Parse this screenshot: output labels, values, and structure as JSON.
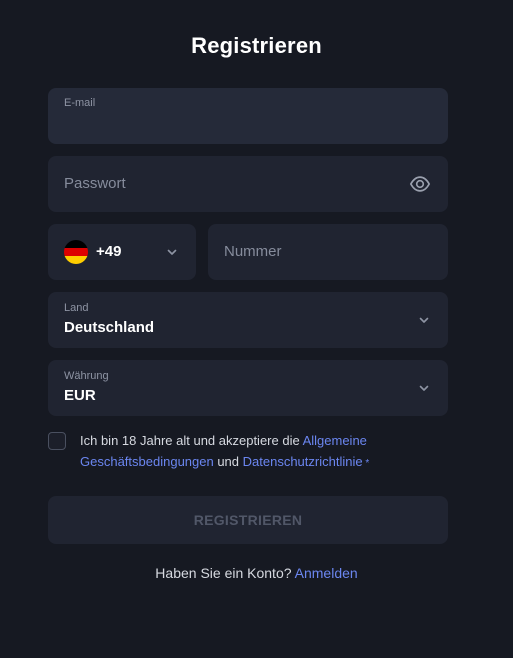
{
  "page": {
    "title": "Registrieren"
  },
  "form": {
    "email": {
      "label": "E-mail",
      "value": ""
    },
    "password": {
      "placeholder": "Passwort",
      "toggle_icon": "eye-icon"
    },
    "phone": {
      "country_code": "+49",
      "flag": "germany-flag",
      "flag_colors": [
        "#000000",
        "#dd0000",
        "#ffce00"
      ],
      "placeholder": "Nummer"
    },
    "country": {
      "label": "Land",
      "value": "Deutschland"
    },
    "currency": {
      "label": "Währung",
      "value": "EUR"
    },
    "consent": {
      "text_before": "Ich bin 18 Jahre alt und akzeptiere die ",
      "terms_link": "Allgemeine Geschäftsbedingungen",
      "text_middle": " und ",
      "privacy_link": "Datenschutzrichtlinie",
      "required_mark": " *",
      "checked": false
    },
    "submit_label": "REGISTRIEREN"
  },
  "footer": {
    "question": "Haben Sie ein Konto? ",
    "login_link": "Anmelden"
  },
  "colors": {
    "accent": "#6b86f0",
    "background": "#161922",
    "field": "#202431"
  }
}
